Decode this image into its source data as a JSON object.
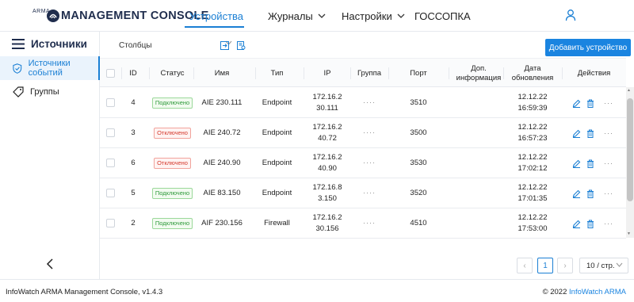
{
  "colors": {
    "accent": "#1a7fd4",
    "button": "#1a84e0",
    "ok": "#2e9a3a",
    "off": "#d4382c"
  },
  "header": {
    "logo_small": "ARMA",
    "logo_text": "MANAGEMENT CONSOLE",
    "nav": [
      {
        "label": "Устройства",
        "active": true,
        "has_dropdown": true
      },
      {
        "label": "Журналы",
        "has_dropdown": true
      },
      {
        "label": "Настройки",
        "has_dropdown": true
      },
      {
        "label": "ГОССОПКА",
        "has_dropdown": false
      }
    ],
    "user_icon": "user-icon"
  },
  "sidebar": {
    "title": "Источники",
    "items": [
      {
        "label": "Источники событий",
        "icon": "shield-check-icon",
        "active": true
      },
      {
        "label": "Группы",
        "icon": "tag-icon",
        "active": false
      }
    ],
    "collapse_icon": "chevron-left-icon"
  },
  "toolbar": {
    "columns_label": "Столбцы",
    "add_button": "Добавить устройство"
  },
  "table": {
    "headers": {
      "id": "ID",
      "status": "Статус",
      "name": "Имя",
      "type": "Тип",
      "ip": "IP",
      "group": "Группа",
      "port": "Порт",
      "extra_1": "Доп.",
      "extra_2": "информация",
      "updated_1": "Дата",
      "updated_2": "обновления",
      "actions": "Действия"
    },
    "rows": [
      {
        "id": "4",
        "status": "Подключено",
        "status_kind": "ok",
        "name": "AIE 230.111",
        "type": "Endpoint",
        "ip_1": "172.16.2",
        "ip_2": "30.111",
        "group": "····",
        "port": "3510",
        "date": "12.12.22",
        "time": "16:59:39"
      },
      {
        "id": "3",
        "status": "Отключено",
        "status_kind": "off",
        "name": "AIE 240.72",
        "type": "Endpoint",
        "ip_1": "172.16.2",
        "ip_2": "40.72",
        "group": "····",
        "port": "3500",
        "date": "12.12.22",
        "time": "16:57:23"
      },
      {
        "id": "6",
        "status": "Отключено",
        "status_kind": "off",
        "name": "AIE 240.90",
        "type": "Endpoint",
        "ip_1": "172.16.2",
        "ip_2": "40.90",
        "group": "····",
        "port": "3530",
        "date": "12.12.22",
        "time": "17:02:12"
      },
      {
        "id": "5",
        "status": "Подключено",
        "status_kind": "ok",
        "name": "AIE 83.150",
        "type": "Endpoint",
        "ip_1": "172.16.8",
        "ip_2": "3.150",
        "group": "····",
        "port": "3520",
        "date": "12.12.22",
        "time": "17:01:35"
      },
      {
        "id": "2",
        "status": "Подключено",
        "status_kind": "ok",
        "name": "AIF 230.156",
        "type": "Firewall",
        "ip_1": "172.16.2",
        "ip_2": "30.156",
        "group": "····",
        "port": "4510",
        "date": "12.12.22",
        "time": "17:53:00"
      }
    ],
    "row_actions": {
      "edit_icon": "edit-icon",
      "delete_icon": "trash-icon",
      "more": "···"
    }
  },
  "pagination": {
    "prev": "‹",
    "current_page": "1",
    "next": "›",
    "page_size": "10 / стр."
  },
  "footer": {
    "version": "InfoWatch ARMA Management Console, v1.4.3",
    "copyright": "© 2022 ",
    "brand_link": "InfoWatch ARMA"
  }
}
